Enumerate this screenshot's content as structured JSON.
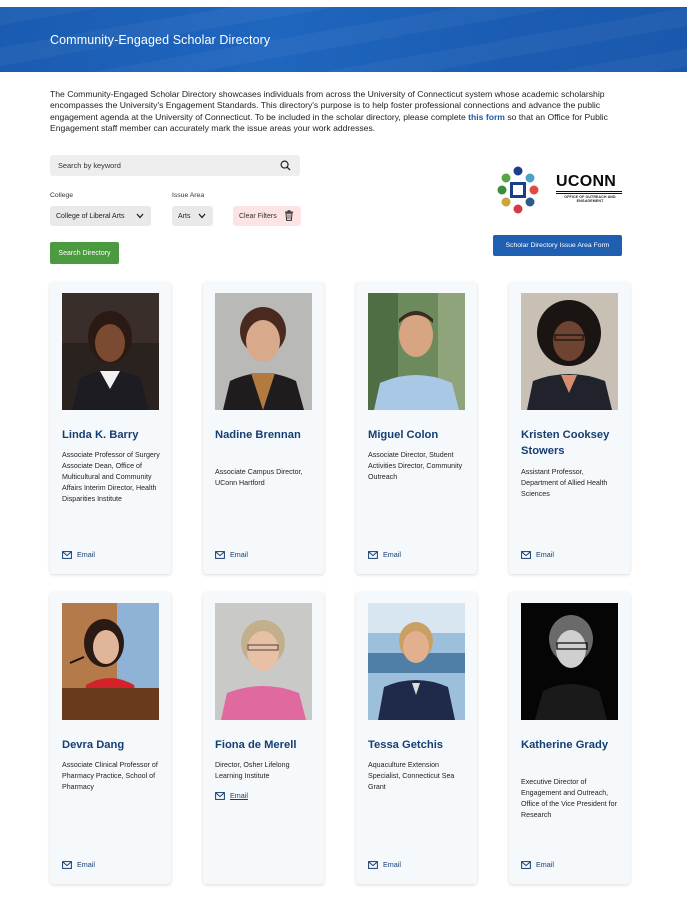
{
  "header": {
    "title": "Community-Engaged Scholar Directory"
  },
  "intro": {
    "text_before": "The Community-Engaged Scholar Directory showcases individuals from across the University of Connecticut system whose academic scholarship encompasses the University's Engagement Standards. This directory's purpose is to help foster professional connections and advance the public engagement agenda at the University of Connecticut. To be included in the scholar directory, please complete ",
    "link_text": "this form",
    "text_after": " so that an Office for Public Engagement staff member can accurately mark the issue areas your work addresses."
  },
  "search": {
    "placeholder": "Search by keyword"
  },
  "filters": {
    "college_label": "College",
    "college_value": "College of Liberal Arts",
    "issue_label": "Issue Area",
    "issue_value": "Arts",
    "clear_label": "Clear Filters"
  },
  "buttons": {
    "search_directory": "Search Directory",
    "issue_area_form": "Scholar Directory Issue Area Form"
  },
  "logo": {
    "wordmark": "UCONN",
    "subtext": "OFFICE OF OUTREACH AND ENGAGEMENT"
  },
  "email_label": "Email",
  "scholars": [
    {
      "name": "Linda K. Barry",
      "title": "Associate Professor of Surgery Associate Dean, Office of Multicultural and Community Affairs Interim Director, Health Disparities Institute"
    },
    {
      "name": "Nadine Brennan",
      "title": "Associate Campus Director, UConn Hartford"
    },
    {
      "name": "Miguel Colon",
      "title": "Associate Director, Student Activities Director, Community Outreach"
    },
    {
      "name": "Kristen Cooksey Stowers",
      "title": "Assistant Professor, Department of Allied Health Sciences"
    },
    {
      "name": "Devra Dang",
      "title": "Associate Clinical Professor of Pharmacy Practice, School of Pharmacy"
    },
    {
      "name": "Fiona de Merell",
      "title": "Director, Osher Lifelong Learning Institute"
    },
    {
      "name": "Tessa Getchis",
      "title": "Aquaculture Extension Specialist, Connecticut Sea Grant"
    },
    {
      "name": "Katherine Grady",
      "title": "Executive Director of Engagement and Outreach, Office of the Vice President for Research"
    }
  ],
  "colors": {
    "banner": "#1b5fb4",
    "name_text": "#153e73",
    "search_button": "#4c9a3f",
    "form_button": "#1f5fb2",
    "clear_filters_bg": "#fde4e4"
  }
}
